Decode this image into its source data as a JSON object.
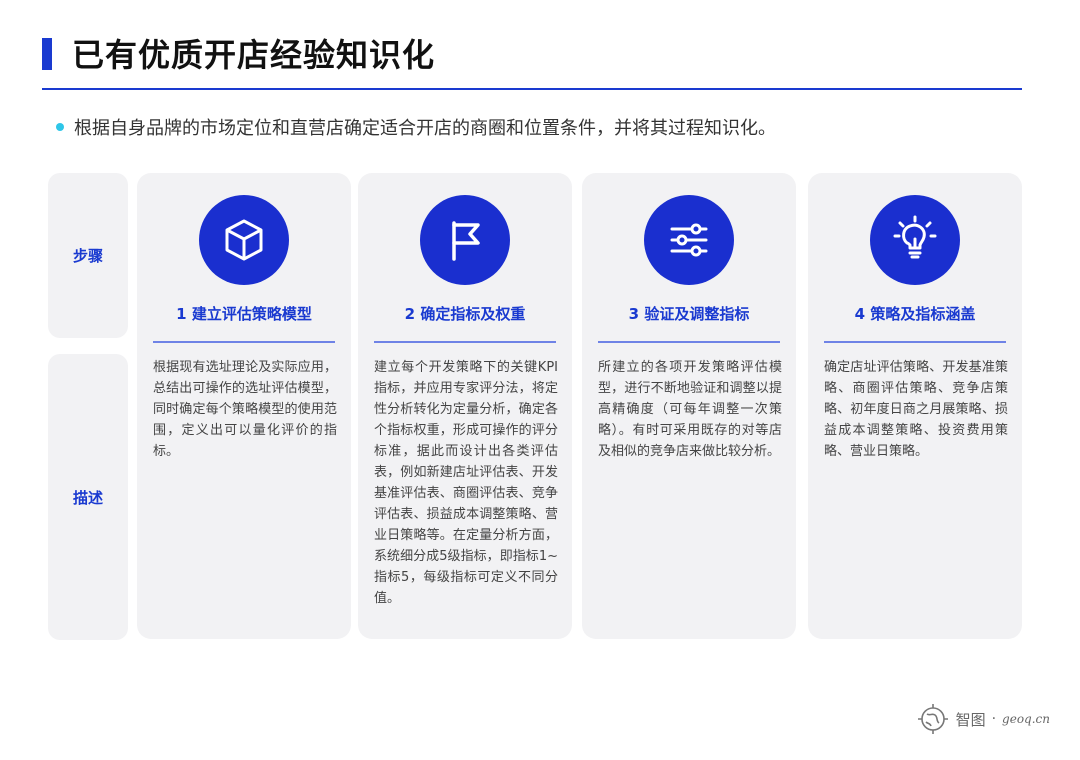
{
  "header": {
    "title": "已有优质开店经验知识化",
    "subtitle": "根据自身品牌的市场定位和直营店确定适合开店的商圈和位置条件，并将其过程知识化。"
  },
  "side": {
    "steps_label": "步骤",
    "desc_label": "描述"
  },
  "cards": [
    {
      "icon": "cube-icon",
      "title": "1 建立评估策略模型",
      "desc": "根据现有选址理论及实际应用，总结出可操作的选址评估模型，同时确定每个策略模型的使用范围，定义出可以量化评价的指标。"
    },
    {
      "icon": "flag-icon",
      "title": "2 确定指标及权重",
      "desc": "建立每个开发策略下的关键KPI指标，并应用专家评分法，将定性分析转化为定量分析，确定各个指标权重，形成可操作的评分标准，据此而设计出各类评估表，例如新建店址评估表、开发基准评估表、商圈评估表、竞争评估表、损益成本调整策略、营业日策略等。在定量分析方面，系统细分成5级指标，即指标1~指标5，每级指标可定义不同分值。"
    },
    {
      "icon": "sliders-icon",
      "title": "3 验证及调整指标",
      "desc": "所建立的各项开发策略评估模型，进行不断地验证和调整以提高精确度（可每年调整一次策略）。有时可采用既存的对等店及相似的竞争店来做比较分析。"
    },
    {
      "icon": "lightbulb-icon",
      "title": "4 策略及指标涵盖",
      "desc": "确定店址评估策略、开发基准策略、商圈评估策略、竞争店策略、初年度日商之月展策略、损益成本调整策略、投资费用策略、营业日策略。"
    }
  ],
  "logo": {
    "name": "智图",
    "url": "geoq.cn"
  },
  "colors": {
    "accent": "#1a3ad0",
    "icon_bg": "#1a2fcf",
    "bullet": "#2ec6e8",
    "card_bg": "#f2f2f4"
  }
}
